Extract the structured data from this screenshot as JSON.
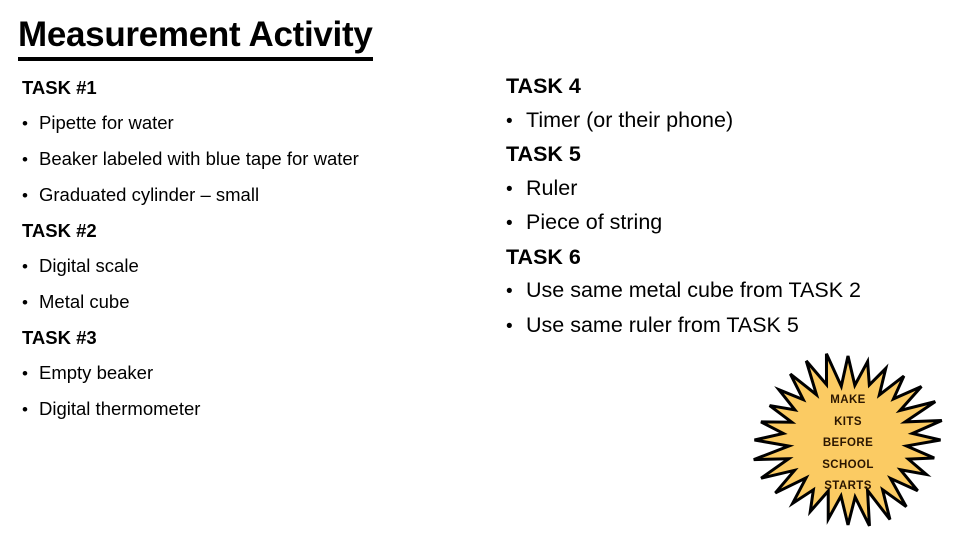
{
  "slide": {
    "title": "Measurement Activity",
    "background_color": "#FFFFFF",
    "text_color": "#000000"
  },
  "left_column": {
    "blocks": [
      {
        "heading": "TASK #1",
        "items": [
          "Pipette for water",
          "Beaker labeled with blue tape for water",
          "Graduated cylinder – small"
        ]
      },
      {
        "heading": "TASK #2",
        "items": [
          "Digital scale",
          "Metal cube"
        ]
      },
      {
        "heading": "TASK #3",
        "items": [
          "Empty beaker",
          "Digital thermometer"
        ]
      }
    ]
  },
  "right_column": {
    "blocks": [
      {
        "heading": "TASK 4",
        "items": [
          "Timer (or their phone)"
        ]
      },
      {
        "heading": "TASK 5",
        "items": [
          "Ruler",
          "Piece of string"
        ]
      },
      {
        "heading": "TASK 6",
        "items": [
          "Use same metal cube from TASK 2",
          "Use same ruler from TASK 5"
        ]
      }
    ]
  },
  "starburst": {
    "fill_color": "#FBCB63",
    "outline_color": "#000000",
    "text_color": "#2B1600",
    "lines": [
      "MAKE",
      "KITS",
      "BEFORE",
      "SCHOOL",
      "STARTS"
    ]
  },
  "bullet_glyph": "•"
}
